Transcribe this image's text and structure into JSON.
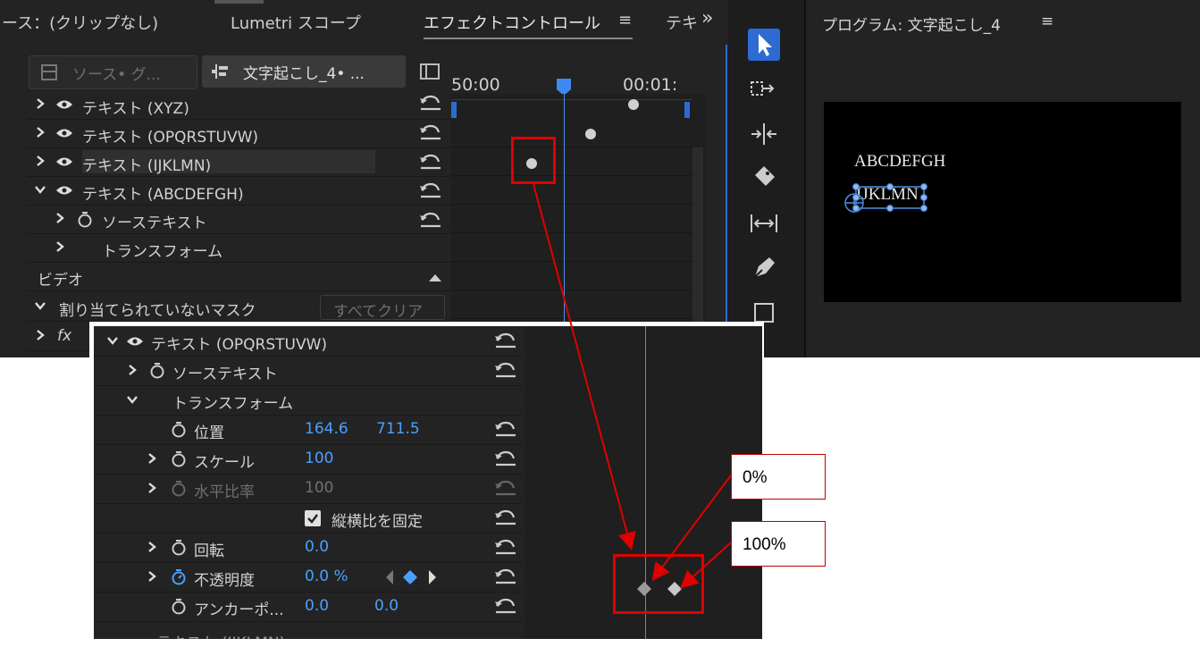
{
  "tabs": {
    "source": "ース：(クリップなし)",
    "lumetri": "Lumetri スコープ",
    "effect_controls": "エフェクトコントロール",
    "text_tab": "テキ",
    "menu_glyph": "≡",
    "overflow": "»"
  },
  "effect_panel": {
    "source_tab": "ソース• グ...",
    "sequence_tab": "文字起こし_4• ...",
    "timecodes": [
      "50:00",
      "00:01:"
    ],
    "rows": [
      {
        "label": "テキスト (XYZ)"
      },
      {
        "label": "テキスト (OPQRSTUVW)"
      },
      {
        "label": "テキスト (IJKLMN)"
      },
      {
        "label": "テキスト (ABCDEFGH)"
      },
      {
        "label": "ソーステキスト"
      },
      {
        "label": "トランスフォーム"
      }
    ],
    "video_label": "ビデオ",
    "mask_label": "割り当てられていないマスク",
    "clear_all": "すべてクリア",
    "fx_label": "fx"
  },
  "program": {
    "title": "プログラム: 文字起こし_4",
    "menu_glyph": "≡",
    "line1": "ABCDEFGH",
    "line2": "IJKLMN"
  },
  "overlay": {
    "rows": [
      {
        "label": "テキスト (OPQRSTUVW)"
      },
      {
        "label": "ソーステキスト"
      },
      {
        "label": "トランスフォーム"
      },
      {
        "label": "位置",
        "v1": "164.6",
        "v2": "711.5"
      },
      {
        "label": "スケール",
        "v1": "100"
      },
      {
        "label": "水平比率",
        "v1": "100"
      },
      {
        "label": "縦横比を固定"
      },
      {
        "label": "回転",
        "v1": "0.0"
      },
      {
        "label": "不透明度",
        "v1": "0.0 %"
      },
      {
        "label": "アンカーポ...",
        "v1": "0.0",
        "v2": "0.0"
      },
      {
        "label": "テキスト (IJKLMN)"
      }
    ]
  },
  "callouts": {
    "zero": "0%",
    "hundred": "100%"
  },
  "colors": {
    "accent": "#2d6bd2",
    "annotation": "#e00000",
    "value_blue": "#4aa0ff"
  }
}
